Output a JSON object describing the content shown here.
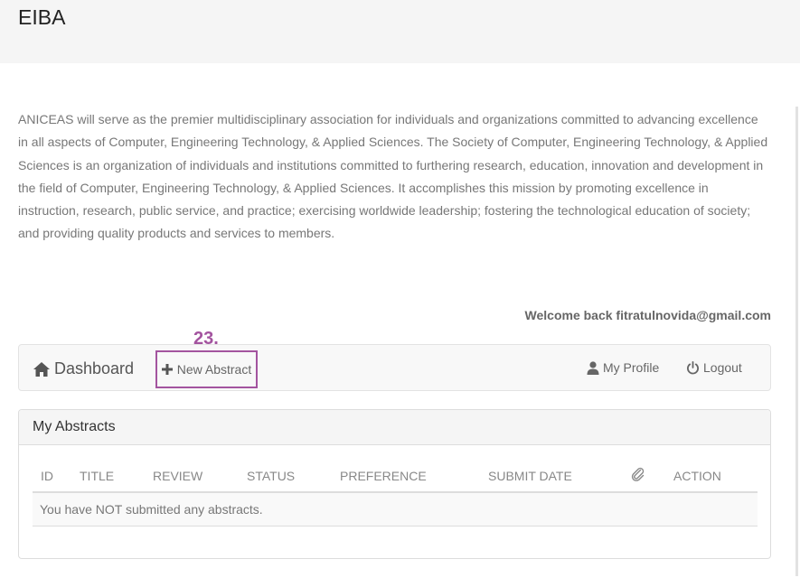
{
  "header": {
    "title": "EIBA"
  },
  "about": {
    "text": "ANICEAS will serve as the premier multidisciplinary association for individuals and organizations committed to advancing excellence in all aspects of Computer, Engineering Technology, & Applied Sciences. The Society of Computer, Engineering Technology, & Applied Sciences is an organization of individuals and institutions committed to furthering research, education, innovation and development in the field of Computer, Engineering Technology, & Applied Sciences. It accomplishes this mission by promoting excellence in instruction, research, public service, and practice; exercising worldwide leadership; fostering the technological education of society; and providing quality products and services to members."
  },
  "welcome": "Welcome back fitratulnovida@gmail.com",
  "annotation": "23.",
  "nav": {
    "dashboard": "Dashboard",
    "new_abstract": "New Abstract",
    "my_profile": "My Profile",
    "logout": "Logout",
    "icons": [
      "home-icon",
      "plus-icon",
      "user-icon",
      "power-icon"
    ]
  },
  "panel": {
    "title": "My Abstracts",
    "columns": [
      "ID",
      "TITLE",
      "REVIEW",
      "STATUS",
      "PREFERENCE",
      "SUBMIT DATE",
      "ACTION"
    ],
    "empty_message": "You have NOT submitted any abstracts."
  },
  "colors": {
    "annotation": "#a3549f",
    "header_bg": "#f5f5f5",
    "navbar_bg": "#f8f8f8"
  }
}
